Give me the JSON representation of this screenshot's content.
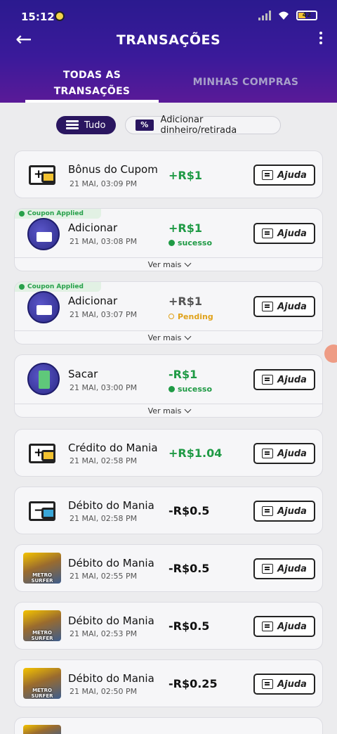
{
  "status_bar": {
    "time": "15:12",
    "battery": "42"
  },
  "header": {
    "title": "TRANSAÇÕES"
  },
  "tabs": [
    {
      "label_line1": "TODAS AS",
      "label_line2": "TRANSAÇÕES",
      "active": true
    },
    {
      "label": "MINHAS COMPRAS",
      "active": false
    }
  ],
  "filters": [
    {
      "label": "Tudo",
      "active": true
    },
    {
      "label": "Adicionar dinheiro/retirada",
      "active": false
    }
  ],
  "help_label": "Ajuda",
  "see_more_label": "Ver mais",
  "coupon_label": "Coupon Applied",
  "transactions": [
    {
      "name": "Bônus do Cupom",
      "date": "21 MAI, 03:09 PM",
      "amount": "+R$1",
      "icon": "wallet-plus-icon"
    },
    {
      "name": "Adicionar",
      "date": "21 MAI, 03:08 PM",
      "amount": "+R$1",
      "status": "sucesso",
      "icon": "add-money-icon"
    },
    {
      "name": "Adicionar",
      "date": "21 MAI, 03:07 PM",
      "amount": "+R$1",
      "status": "Pending",
      "icon": "add-money-icon"
    },
    {
      "name": "Sacar",
      "date": "21 MAI, 03:00 PM",
      "amount": "-R$1",
      "status": "sucesso",
      "icon": "withdraw-icon"
    },
    {
      "name": "Crédito do Mania",
      "date": "21 MAI, 02:58 PM",
      "amount": "+R$1.04",
      "icon": "wallet-plus-icon"
    },
    {
      "name": "Débito do Mania",
      "date": "21 MAI, 02:58 PM",
      "amount": "-R$0.5",
      "icon": "wallet-minus-icon"
    },
    {
      "name": "Débito do Mania",
      "date": "21 MAI, 02:55 PM",
      "amount": "-R$0.5",
      "icon": "metro-surfer-game-icon",
      "game_label": "METRO SURFER"
    },
    {
      "name": "Débito do Mania",
      "date": "21 MAI, 02:53 PM",
      "amount": "-R$0.5",
      "icon": "metro-surfer-game-icon",
      "game_label": "METRO SURFER"
    },
    {
      "name": "Débito do Mania",
      "date": "21 MAI, 02:50 PM",
      "amount": "-R$0.25",
      "icon": "metro-surfer-game-icon",
      "game_label": "METRO SURFER"
    }
  ],
  "colors": {
    "header": "#3a1a9a",
    "positive": "#1f9a45",
    "pending": "#e0a21a",
    "chip_active": "#2a1660"
  }
}
